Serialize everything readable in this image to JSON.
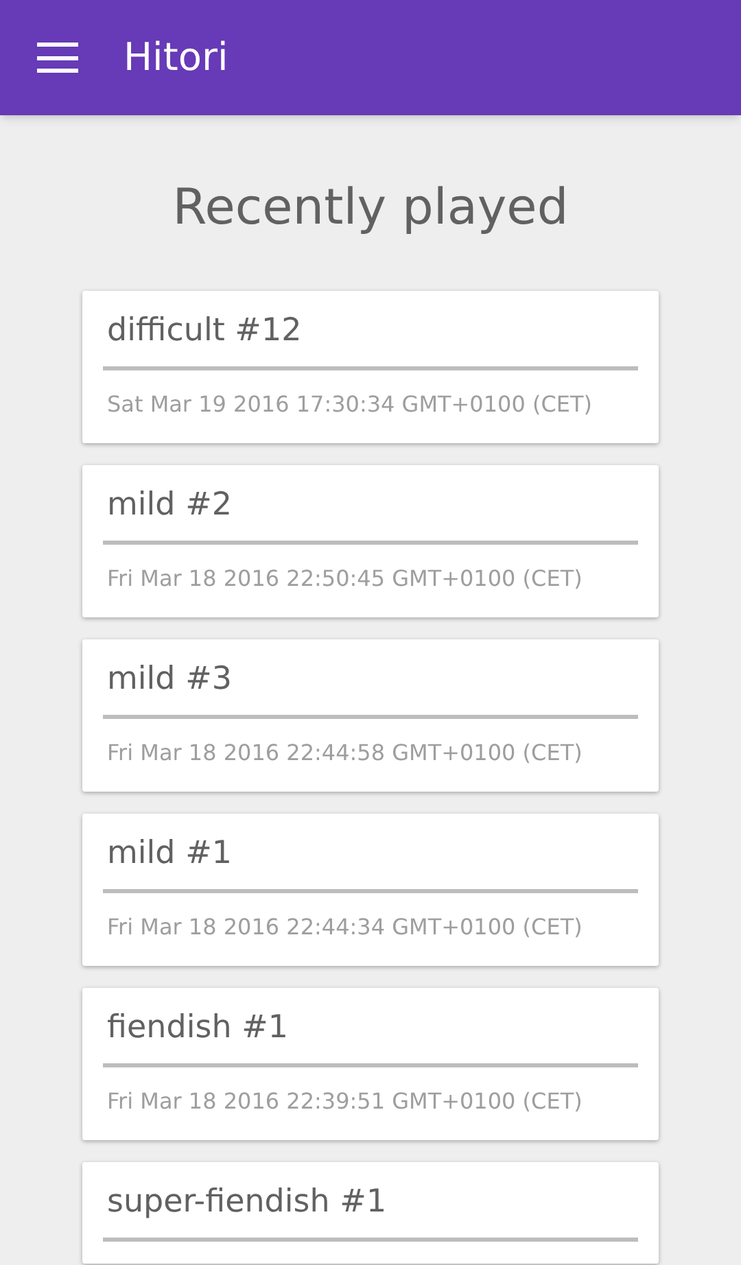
{
  "app_bar": {
    "title": "Hitori"
  },
  "heading": "Recently played",
  "games": [
    {
      "name": "difficult #12",
      "played": "Sat Mar 19 2016 17:30:34 GMT+0100 (CET)"
    },
    {
      "name": "mild #2",
      "played": "Fri Mar 18 2016 22:50:45 GMT+0100 (CET)"
    },
    {
      "name": "mild #3",
      "played": "Fri Mar 18 2016 22:44:58 GMT+0100 (CET)"
    },
    {
      "name": "mild #1",
      "played": "Fri Mar 18 2016 22:44:34 GMT+0100 (CET)"
    },
    {
      "name": "fiendish #1",
      "played": "Fri Mar 18 2016 22:39:51 GMT+0100 (CET)"
    },
    {
      "name": "super-fiendish #1"
    }
  ]
}
